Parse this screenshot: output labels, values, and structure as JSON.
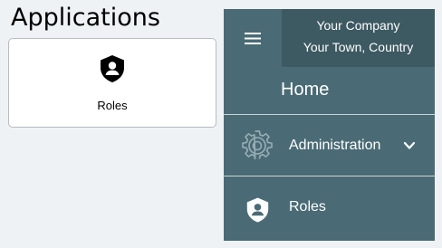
{
  "applications": {
    "title": "Applications",
    "cards": [
      {
        "label": "Roles",
        "icon": "shield-user-icon"
      }
    ]
  },
  "nav": {
    "menu_icon": "hamburger-icon",
    "company": {
      "name": "Your Company",
      "location": "Your Town, Country"
    },
    "home_label": "Home",
    "items": [
      {
        "label": "Administration",
        "icon": "gear-icon",
        "expandable": true,
        "expand_icon": "chevron-down-icon"
      },
      {
        "label": "Roles",
        "icon": "shield-user-icon",
        "expandable": false
      }
    ]
  },
  "colors": {
    "page_background": "#eef2f5",
    "nav_background": "#4a6b75",
    "company_background": "#3d5962",
    "card_background": "#ffffff",
    "card_border": "#b8bcc0",
    "nav_text": "#ffffff",
    "gear_icon": "#9aaeb4"
  }
}
